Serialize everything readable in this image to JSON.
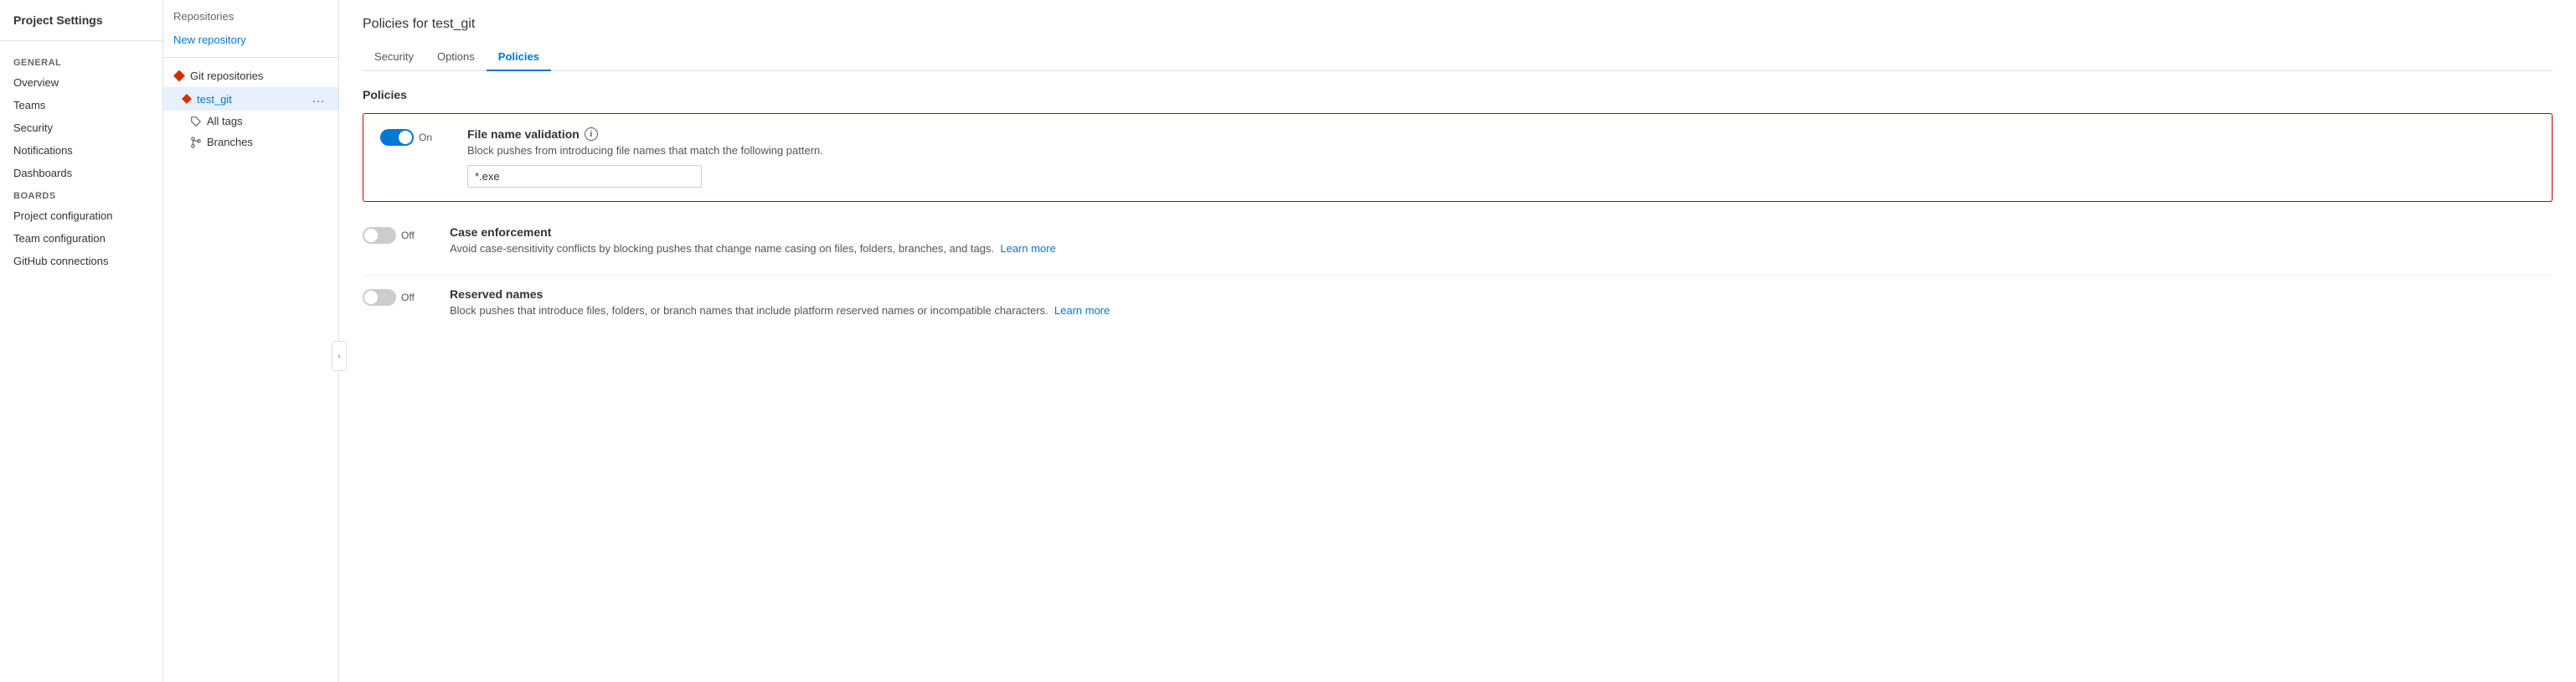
{
  "sidebar": {
    "title": "Project Settings",
    "sections": [
      {
        "label": "General",
        "items": [
          {
            "id": "overview",
            "label": "Overview"
          },
          {
            "id": "teams",
            "label": "Teams"
          },
          {
            "id": "security",
            "label": "Security"
          },
          {
            "id": "notifications",
            "label": "Notifications"
          },
          {
            "id": "dashboards",
            "label": "Dashboards"
          }
        ]
      },
      {
        "label": "Boards",
        "items": [
          {
            "id": "project-config",
            "label": "Project configuration"
          },
          {
            "id": "team-config",
            "label": "Team configuration"
          },
          {
            "id": "github-connections",
            "label": "GitHub connections"
          }
        ]
      }
    ]
  },
  "midpanel": {
    "title": "Repositories",
    "new_repo_label": "New repository",
    "git_repos_label": "Git repositories",
    "repo_name": "test_git",
    "all_tags_label": "All tags",
    "branches_label": "Branches"
  },
  "main": {
    "page_title": "Policies for test_git",
    "tabs": [
      {
        "id": "security",
        "label": "Security",
        "active": false
      },
      {
        "id": "options",
        "label": "Options",
        "active": false
      },
      {
        "id": "policies",
        "label": "Policies",
        "active": true
      }
    ],
    "section_title": "Policies",
    "policies": [
      {
        "id": "file-name-validation",
        "enabled": true,
        "toggle_label": "On",
        "name": "File name validation",
        "has_info": true,
        "description": "Block pushes from introducing file names that match the following pattern.",
        "has_input": true,
        "input_value": "*.exe",
        "highlighted": true
      },
      {
        "id": "case-enforcement",
        "enabled": false,
        "toggle_label": "Off",
        "name": "Case enforcement",
        "has_info": false,
        "description": "Avoid case-sensitivity conflicts by blocking pushes that change name casing on files, folders, branches, and tags.",
        "has_learn_more": true,
        "learn_more_label": "Learn more",
        "highlighted": false
      },
      {
        "id": "reserved-names",
        "enabled": false,
        "toggle_label": "Off",
        "name": "Reserved names",
        "has_info": false,
        "description": "Block pushes that introduce files, folders, or branch names that include platform reserved names or incompatible characters.",
        "has_learn_more": true,
        "learn_more_label": "Learn more",
        "highlighted": false
      }
    ]
  }
}
